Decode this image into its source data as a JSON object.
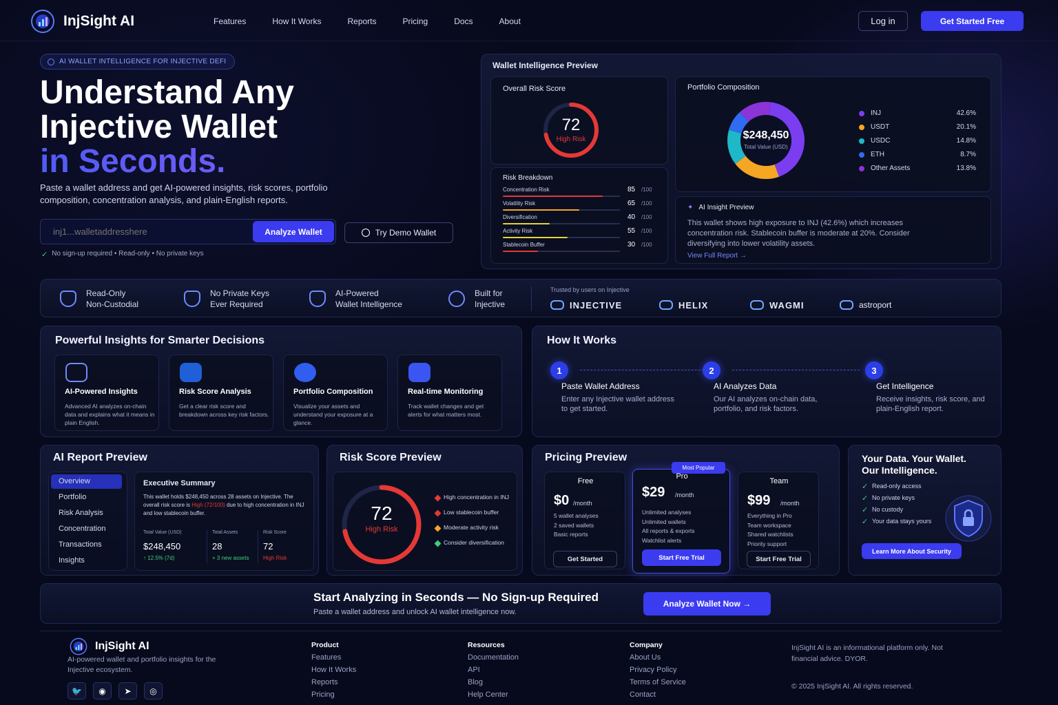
{
  "brand": {
    "name": "InjSight AI"
  },
  "nav": {
    "items": [
      "Features",
      "How It Works",
      "Reports",
      "Pricing",
      "Docs",
      "About"
    ],
    "login": "Log in",
    "cta": "Get Started Free"
  },
  "hero": {
    "badge": "AI WALLET INTELLIGENCE FOR INJECTIVE DEFI",
    "title_line1": "Understand Any",
    "title_line2": "Injective Wallet",
    "title_line3": "in Seconds.",
    "subtitle": "Paste a wallet address and get AI-powered insights, risk scores, portfolio composition, concentration analysis, and plain-English reports.",
    "input_placeholder": "inj1...walletaddresshere",
    "analyze_button": "Analyze Wallet",
    "demo_button": "Try Demo Wallet",
    "note": "No sign-up required • Read-only • No private keys"
  },
  "preview": {
    "title": "Wallet Intelligence Preview",
    "risk": {
      "label": "Overall Risk Score",
      "score": "72",
      "level": "High Risk",
      "fraction": 0.72
    },
    "breakdown": {
      "title": "Risk Breakdown",
      "items": [
        {
          "label": "Concentration Risk",
          "value": "85",
          "max": "/100",
          "color": "#e53935",
          "fraction": 0.85
        },
        {
          "label": "Volatility Risk",
          "value": "65",
          "max": "/100",
          "color": "#f5a623",
          "fraction": 0.65
        },
        {
          "label": "Diversification",
          "value": "40",
          "max": "/100",
          "color": "#e6d334",
          "fraction": 0.4
        },
        {
          "label": "Activity Risk",
          "value": "55",
          "max": "/100",
          "color": "#e6d334",
          "fraction": 0.55
        },
        {
          "label": "Stablecoin Buffer",
          "value": "30",
          "max": "/100",
          "color": "#e53935",
          "fraction": 0.3
        }
      ]
    },
    "portfolio": {
      "title": "Portfolio Composition",
      "total": "$248,450",
      "total_label": "Total Value (USD)",
      "assets": [
        {
          "name": "INJ",
          "pct": "42.6%",
          "value": 42.6,
          "color": "#7b3df0"
        },
        {
          "name": "USDT",
          "pct": "20.1%",
          "value": 20.1,
          "color": "#f5a623"
        },
        {
          "name": "USDC",
          "pct": "14.8%",
          "value": 14.8,
          "color": "#1fb8c8"
        },
        {
          "name": "ETH",
          "pct": "8.7%",
          "value": 8.7,
          "color": "#2f6cf0"
        },
        {
          "name": "Other Assets",
          "pct": "13.8%",
          "value": 13.8,
          "color": "#8b34d8"
        }
      ]
    },
    "insight": {
      "title": "AI Insight Preview",
      "text": "This wallet shows high exposure to INJ (42.6%) which increases concentration risk. Stablecoin buffer is moderate at 20%. Consider diversifying into lower volatility assets.",
      "link": "View Full Report →"
    }
  },
  "trust": {
    "items": [
      {
        "l1": "Read-Only",
        "l2": "Non-Custodial"
      },
      {
        "l1": "No Private Keys",
        "l2": "Ever Required"
      },
      {
        "l1": "AI-Powered",
        "l2": "Wallet Intelligence"
      },
      {
        "l1": "Built for",
        "l2": "Injective"
      }
    ],
    "trusted_label": "Trusted by users on Injective",
    "logos": [
      "INJECTIVE",
      "HELIX",
      "WAGMI",
      "astroport"
    ]
  },
  "insights": {
    "title": "Powerful Insights for Smarter Decisions",
    "cards": [
      {
        "title": "AI-Powered Insights",
        "text": "Advanced AI analyzes on-chain data and explains what it means in plain English."
      },
      {
        "title": "Risk Score Analysis",
        "text": "Get a clear risk score and breakdown across key risk factors."
      },
      {
        "title": "Portfolio Composition",
        "text": "Visualize your assets and understand your exposure at a glance."
      },
      {
        "title": "Real-time Monitoring",
        "text": "Track wallet changes and get alerts for what matters most."
      }
    ]
  },
  "how": {
    "title": "How It Works",
    "steps": [
      {
        "n": "1",
        "title": "Paste Wallet Address",
        "text": "Enter any Injective wallet address to get started."
      },
      {
        "n": "2",
        "title": "AI Analyzes Data",
        "text": "Our AI analyzes on-chain data, portfolio, and risk factors."
      },
      {
        "n": "3",
        "title": "Get Intelligence",
        "text": "Receive insights, risk score, and plain-English report."
      }
    ]
  },
  "report": {
    "title": "AI Report Preview",
    "menu": [
      "Overview",
      "Portfolio",
      "Risk Analysis",
      "Concentration",
      "Transactions",
      "Insights"
    ],
    "exec_title": "Executive Summary",
    "exec_text_a": "This wallet holds $248,450 across 28 assets on Injective. The overall risk score is ",
    "exec_text_hl": "High (72/100)",
    "exec_text_b": " due to high concentration in INJ and low stablecoin buffer.",
    "stats": [
      {
        "label": "Total Value (USD)",
        "value": "$248,450",
        "sub": "↑ 12.5% (7d)"
      },
      {
        "label": "Total Assets",
        "value": "28",
        "sub": "+ 3 new assets"
      },
      {
        "label": "Risk Score",
        "value": "72",
        "sub": "High Risk"
      }
    ]
  },
  "riskprev": {
    "title": "Risk Score Preview",
    "score": "72",
    "level": "High Risk",
    "fraction": 0.72,
    "items": [
      {
        "text": "High concentration in INJ",
        "color": "#e53935"
      },
      {
        "text": "Low stablecoin buffer",
        "color": "#e53935"
      },
      {
        "text": "Moderate activity risk",
        "color": "#f5a623"
      },
      {
        "text": "Consider diversification",
        "color": "#3ad17a"
      }
    ]
  },
  "pricing": {
    "title": "Pricing Preview",
    "popular": "Most Popular",
    "plans": [
      {
        "name": "Free",
        "price": "$0",
        "per": "/month",
        "features": [
          "5 wallet analyses",
          "2 saved wallets",
          "Basic reports"
        ],
        "button": "Get Started"
      },
      {
        "name": "Pro",
        "price": "$29",
        "per": "/month",
        "features": [
          "Unlimited analyses",
          "Unlimited wallets",
          "All reports & exports",
          "Watchlist alerts"
        ],
        "button": "Start Free Trial"
      },
      {
        "name": "Team",
        "price": "$99",
        "per": "/month",
        "features": [
          "Everything in Pro",
          "Team workspace",
          "Shared watchlists",
          "Priority support"
        ],
        "button": "Start Free Trial"
      }
    ]
  },
  "security": {
    "title1": "Your Data. Your Wallet.",
    "title2": "Our Intelligence.",
    "items": [
      "Read-only access",
      "No private keys",
      "No custody",
      "Your data stays yours"
    ],
    "button": "Learn More About Security"
  },
  "cta": {
    "title": "Start Analyzing in Seconds — No Sign-up Required",
    "subtitle": "Paste a wallet address and unlock AI wallet intelligence now.",
    "button": "Analyze Wallet Now →"
  },
  "footer": {
    "brand": "InjSight AI",
    "tagline": "AI-powered wallet and portfolio insights for the Injective ecosystem.",
    "cols": [
      {
        "title": "Product",
        "links": [
          "Features",
          "How It Works",
          "Reports",
          "Pricing"
        ]
      },
      {
        "title": "Resources",
        "links": [
          "Documentation",
          "API",
          "Blog",
          "Help Center"
        ]
      },
      {
        "title": "Company",
        "links": [
          "About Us",
          "Privacy Policy",
          "Terms of Service",
          "Contact"
        ]
      }
    ],
    "disclaimer": "InjSight AI is an informational platform only. Not financial advice. DYOR.",
    "copyright": "© 2025 InjSight AI. All rights reserved.",
    "social": [
      "twitter-icon",
      "discord-icon",
      "telegram-icon",
      "github-icon"
    ]
  }
}
